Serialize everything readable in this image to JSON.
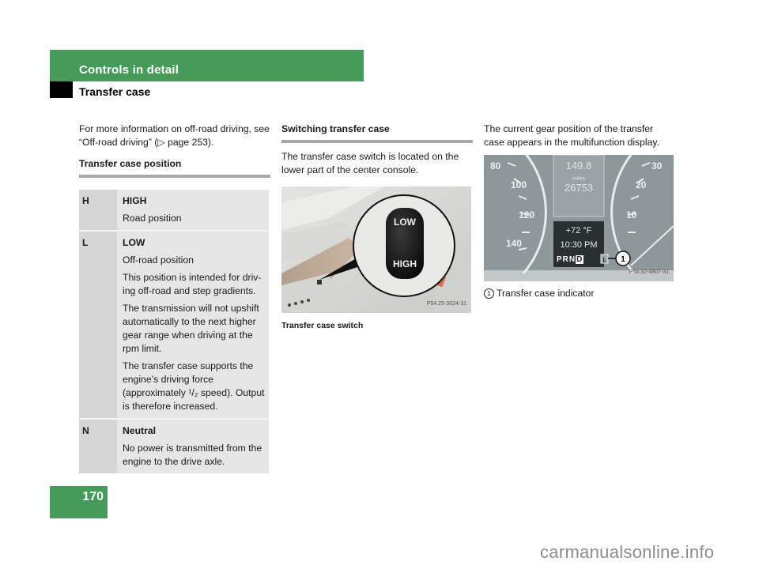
{
  "header": {
    "section_title": "Controls in detail",
    "sub_title": "Transfer case",
    "page_number": "170",
    "accent_color": "#449b5a"
  },
  "column1": {
    "intro": "For more information on off-road driving, see “Off-road driving” (▷ page 253).",
    "heading": "Transfer case position",
    "positions": [
      {
        "key": "H",
        "title": "HIGH",
        "lines": [
          "Road position"
        ]
      },
      {
        "key": "L",
        "title": "LOW",
        "lines": [
          "Off-road position",
          "This position is intended for driv-ing off-road and step gradients.",
          "The transmission will not upshift automatically to the next higher gear range when driving at the rpm limit.",
          "The transfer case supports the engine’s driving force (approximately ¹/₂ speed). Output is therefore increased."
        ]
      },
      {
        "key": "N",
        "title": "Neutral",
        "lines": [
          "No power is transmitted from the engine to the drive axle."
        ]
      }
    ]
  },
  "column2": {
    "heading": "Switching transfer case",
    "body": "The transfer case switch is located on the lower part of the center console.",
    "figure": {
      "switch_top_label": "LOW",
      "switch_bottom_label": "HIGH",
      "code": "P54.25-3024-31",
      "caption": "Transfer case switch"
    }
  },
  "column3": {
    "body": "The current gear position of the transfer case appears in the multifunction display.",
    "figure": {
      "speed_ticks_left": [
        "80",
        "100",
        "120",
        "140"
      ],
      "speed_ticks_right": [
        "30",
        "20",
        "10"
      ],
      "trip": "149.8",
      "unit": "miles",
      "odometer": "26753",
      "temperature": "+72 °F",
      "time": "10:30 PM",
      "gears": [
        "P",
        "R",
        "N",
        "D"
      ],
      "transfer_indicator": "L",
      "callout": "1",
      "code": "P54.32-4807-31"
    },
    "legend": [
      {
        "num": "1",
        "text": "Transfer case indicator"
      }
    ]
  },
  "watermark": "carmanualsonline.info"
}
